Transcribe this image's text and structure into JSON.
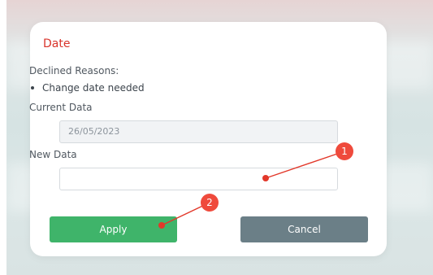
{
  "dialog": {
    "title": "Date",
    "declined_label": "Declined Reasons:",
    "reasons": [
      "Change date needed"
    ],
    "current_label": "Current Data",
    "current_value": "26/05/2023",
    "new_label": "New Data",
    "new_value": "",
    "apply_label": "Apply",
    "cancel_label": "Cancel"
  },
  "annotations": {
    "marker1": "1",
    "marker2": "2"
  },
  "colors": {
    "title": "#d9342b",
    "apply": "#3fb46a",
    "cancel": "#6b7f87",
    "marker": "#ef4a3c"
  }
}
